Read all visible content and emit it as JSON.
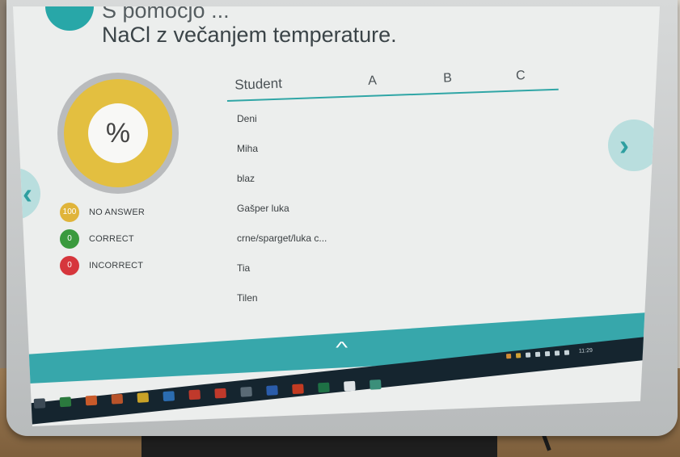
{
  "header": {
    "question_line1": "S pomočjo ...",
    "question_line2": "NaCl z večanjem temperature."
  },
  "donut": {
    "symbol": "%",
    "no_answer_fraction": 1.0
  },
  "legend": [
    {
      "count": "100",
      "label": "NO ANSWER",
      "color": "#e0b43a"
    },
    {
      "count": "0",
      "label": "CORRECT",
      "color": "#3a9a3e"
    },
    {
      "count": "0",
      "label": "INCORRECT",
      "color": "#d6363c"
    }
  ],
  "table": {
    "headers": {
      "student": "Student",
      "a": "A",
      "b": "B",
      "c": "C"
    },
    "students": [
      "Deni",
      "Miha",
      "blaz",
      "Gašper luka",
      "crne/sparget/luka c...",
      "Tia",
      "Tilen"
    ]
  },
  "nav": {
    "prev_icon": "chevron-left-icon",
    "next_icon": "chevron-right-icon"
  },
  "taskbar": {
    "expand_icon": "chevron-up-icon",
    "clock": "11:29"
  },
  "colors": {
    "teal": "#37a7ab",
    "yellow": "#e3bf40",
    "taskbar": "#15252f"
  }
}
